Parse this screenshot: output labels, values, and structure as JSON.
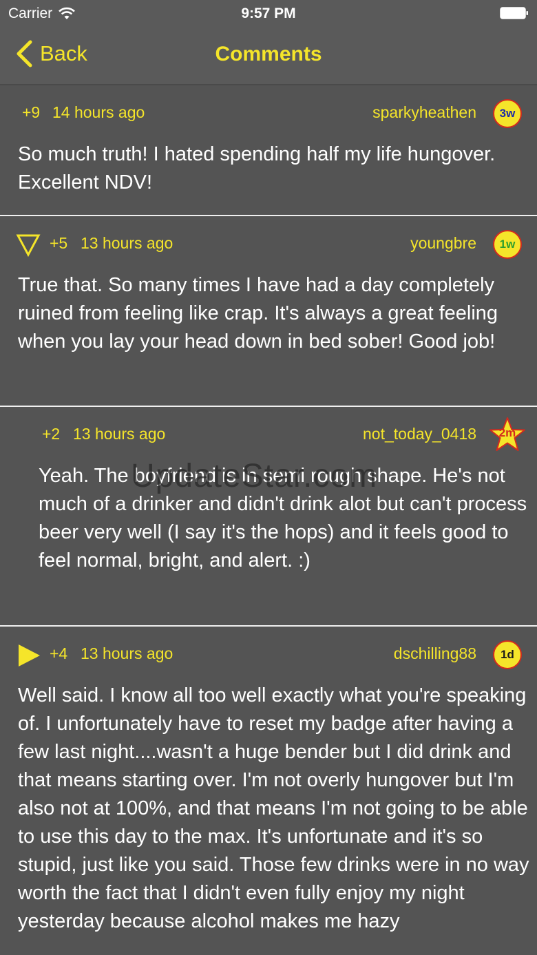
{
  "status": {
    "carrier": "Carrier",
    "time": "9:57 PM"
  },
  "nav": {
    "back_label": "Back",
    "title": "Comments"
  },
  "colors": {
    "accent": "#f5e52a",
    "background": "#545454",
    "badge_border": "#d32a1e",
    "badge_3w": "#1a2aa8",
    "badge_1w": "#2e9e2e",
    "badge_2m": "#d32a1e",
    "badge_1d": "#1a1a1a"
  },
  "comments": [
    {
      "vote_icon": "none",
      "score": "+9",
      "age": "14 hours ago",
      "username": "sparkyheathen",
      "badge": "3w",
      "badge_icon": "circle-badge-icon",
      "body": "So much truth! I hated spending half my life hungover. Excellent NDV!"
    },
    {
      "vote_icon": "triangle-down-outline-icon",
      "score": "+5",
      "age": "13 hours ago",
      "username": "youngbre",
      "badge": "1w",
      "badge_icon": "circle-badge-icon",
      "body": "True that. So many times I have had a day completely ruined from feeling like crap. It's always a great feeling when you lay your head down in bed sober! Good job!"
    },
    {
      "vote_icon": "none",
      "score": "+2",
      "age": "13 hours ago",
      "username": "not_today_0418",
      "badge": "2m",
      "badge_icon": "star-badge-icon",
      "body": "Yeah. The boyfriend is in semi rough shape. He's not much of a drinker and didn't drink alot but can't process beer very well (I say it's the hops) and it feels good to feel normal, bright, and alert. :)"
    },
    {
      "vote_icon": "triangle-right-filled-icon",
      "score": "+4",
      "age": "13 hours ago",
      "username": "dschilling88",
      "badge": "1d",
      "badge_icon": "circle-badge-icon",
      "body": "Well said. I know all too well exactly what you're speaking of. I unfortunately have to reset my badge after having a few last night....wasn't a huge bender but I did drink and that means starting over. I'm not overly hungover but I'm also not at 100%, and that means I'm not going to be able to use this day to the max. It's unfortunate and it's so stupid, just like you said. Those few drinks were in no way worth the fact that I didn't even fully enjoy my night yesterday because alcohol makes me hazy"
    }
  ],
  "watermark": "UpdateStar.com"
}
